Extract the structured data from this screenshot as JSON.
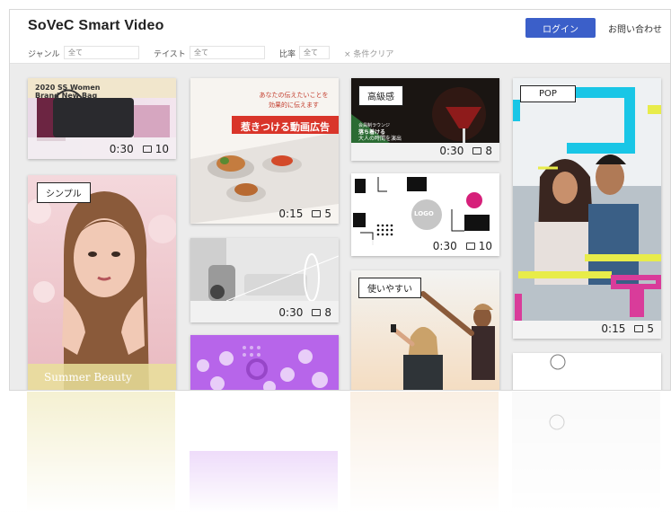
{
  "header": {
    "brand": "SoVeC Smart Video",
    "login_label": "ログイン",
    "contact_label": "お問い合わせ"
  },
  "filters": {
    "genre_label": "ジャンル",
    "genre_value": "全て",
    "taste_label": "テイスト",
    "taste_value": "全て",
    "ratio_label": "比率",
    "ratio_value": "全て",
    "clear_label": "× 条件クリア"
  },
  "cards": {
    "c1": {
      "title_line1": "2020 SS Women",
      "title_line2": "Brand New Bag",
      "duration": "0:30",
      "count": "10"
    },
    "c2": {
      "tag": "シンプル",
      "caption": "Summer Beauty"
    },
    "c3": {
      "copy_line1": "あなたの伝えたいことを",
      "copy_line2": "効果的に伝えます",
      "banner": "惹きつける動画広告",
      "duration": "0:15",
      "count": "5"
    },
    "c4": {
      "duration": "0:30",
      "count": "8"
    },
    "c6": {
      "tag": "高級感",
      "sub_line1": "会員制ラウンジ",
      "sub_line2": "落ち着ける",
      "sub_line3": "大人の時間を演出",
      "duration": "0:30",
      "count": "8"
    },
    "c7": {
      "logo": "LOGO",
      "duration": "0:30",
      "count": "10"
    },
    "c8": {
      "tag": "使いやすい"
    },
    "c9": {
      "tag": "POP",
      "duration": "0:15",
      "count": "5"
    }
  },
  "colors": {
    "accent": "#3b5fc9",
    "banner_red": "#d9352a",
    "pop_cyan": "#19c6e6",
    "pop_magenta": "#d93c9a",
    "pop_yellow": "#e8ec4a",
    "purple": "#b765ea",
    "magenta_dot": "#d6207a"
  }
}
